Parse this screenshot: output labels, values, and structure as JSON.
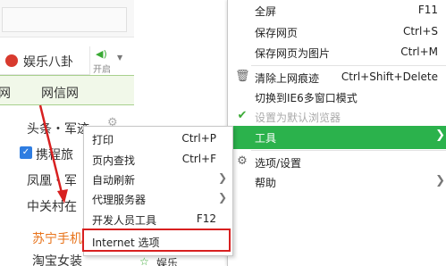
{
  "page": {
    "entertainment": {
      "label": "娱乐八卦",
      "icon": "red-dot-icon"
    },
    "speaker": {
      "label": "开启",
      "icon": "speaker-icon"
    },
    "net_links": [
      "网",
      "网信网"
    ],
    "news": [
      {
        "text": "头条・军迹"
      },
      {
        "text": "携程旅"
      },
      {
        "text": "凤凰・军"
      },
      {
        "text": "中关村在"
      },
      {
        "text": "苏宁手机"
      },
      {
        "text": "淘宝女装"
      }
    ],
    "bottom_star_label": "娱乐"
  },
  "submenu": {
    "items": [
      {
        "label": "打印",
        "shortcut": "Ctrl+P",
        "arrow": false
      },
      {
        "label": "页内查找",
        "shortcut": "Ctrl+F",
        "arrow": false
      },
      {
        "label": "自动刷新",
        "shortcut": "",
        "arrow": true
      },
      {
        "label": "代理服务器",
        "shortcut": "",
        "arrow": true
      },
      {
        "label": "开发人员工具",
        "shortcut": "F12",
        "arrow": false
      },
      {
        "label": "Internet 选项",
        "shortcut": "",
        "arrow": false
      }
    ],
    "highlighted_item": "Internet 选项",
    "highlight_color": "#d82020"
  },
  "mainmenu": {
    "items": [
      {
        "label": "全屏",
        "shortcut": "F11"
      },
      {
        "label": "保存网页",
        "shortcut": "Ctrl+S"
      },
      {
        "label": "保存网页为图片",
        "shortcut": "Ctrl+M"
      },
      {
        "label": "清除上网痕迹",
        "shortcut": "Ctrl+Shift+Delete",
        "icon": "trash-icon"
      },
      {
        "label": "切换到IE6多窗口模式",
        "shortcut": ""
      },
      {
        "label": "设置为默认浏览器",
        "shortcut": "",
        "icon": "check-icon",
        "disabled": true
      },
      {
        "label": "工具",
        "shortcut": "",
        "active": true
      },
      {
        "label": "选项/设置",
        "shortcut": "",
        "icon": "gear-icon"
      },
      {
        "label": "帮助",
        "shortcut": "",
        "arrow": true
      }
    ],
    "active_color": "#2bb24c"
  }
}
